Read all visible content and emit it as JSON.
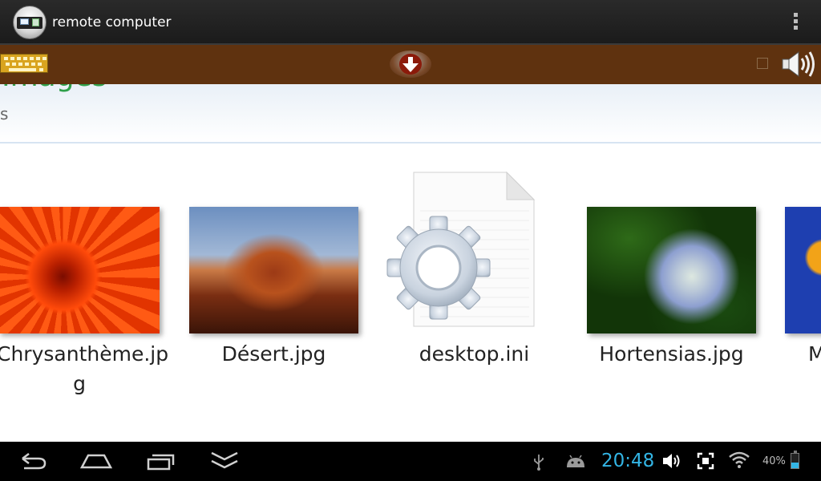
{
  "action_bar": {
    "title": "remote computer",
    "overflow_icon": "overflow-menu-icon"
  },
  "toolbar": {
    "background_color": "#5f320f",
    "keyboard_icon": "keyboard-icon",
    "download_icon": "download-arrow-icon",
    "speaker_icon": "speaker-icon"
  },
  "remote_desktop": {
    "folder_title": "Images",
    "subtitle_fragment": "s",
    "files": [
      {
        "name": "Chrysanthème.jp\ng",
        "type": "image",
        "icon": "chrysanthemum-thumbnail"
      },
      {
        "name": "Désert.jpg",
        "type": "image",
        "icon": "desert-thumbnail"
      },
      {
        "name": "desktop.ini",
        "type": "config",
        "icon": "ini-file-gear-icon"
      },
      {
        "name": "Hortensias.jpg",
        "type": "image",
        "icon": "hydrangea-thumbnail"
      },
      {
        "name": "M",
        "type": "image",
        "icon": "partial-thumbnail"
      }
    ]
  },
  "navbar": {
    "back_icon": "back-icon",
    "home_icon": "home-icon",
    "recents_icon": "recent-apps-icon",
    "hide_icon": "hide-keyboard-icon",
    "status": {
      "time": "20:48",
      "battery": "40%",
      "battery_level": 0.4,
      "accent_color": "#33b5e5"
    }
  }
}
